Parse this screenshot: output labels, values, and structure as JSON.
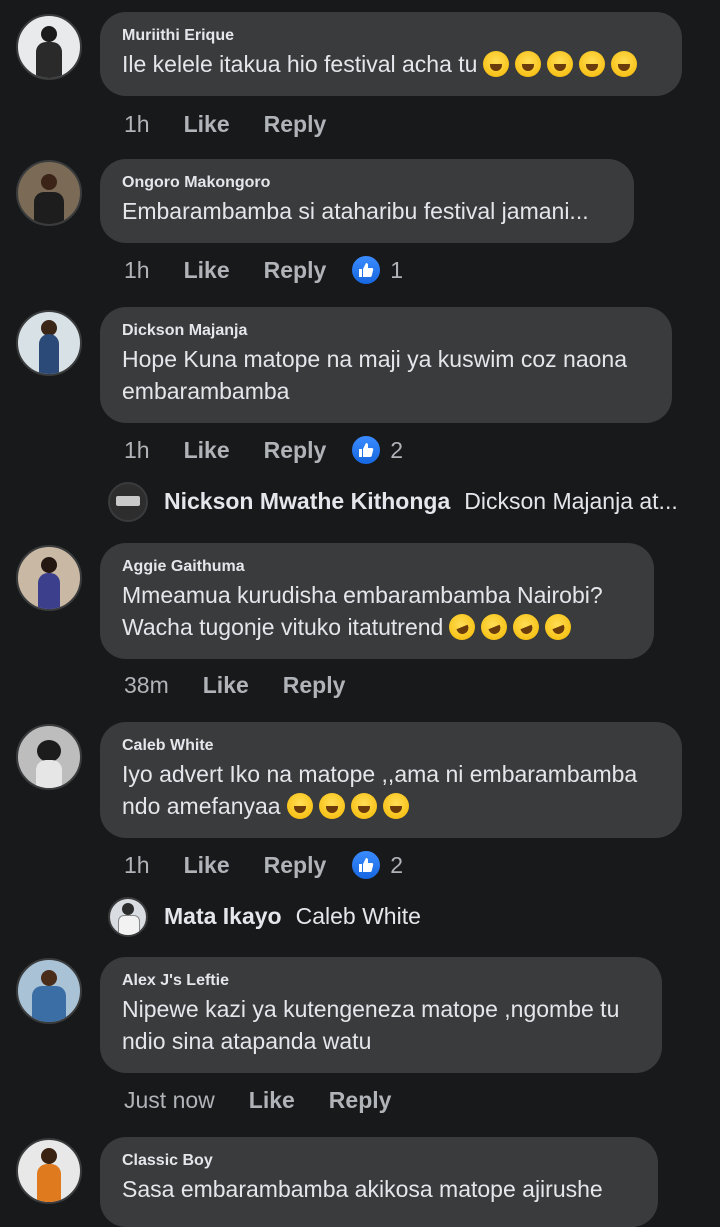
{
  "comments": [
    {
      "author": "Muriithi Erique",
      "text": "Ile kelele itakua hio festival acha tu",
      "emoji_count": 5,
      "time": "1h",
      "like": "Like",
      "reply": "Reply",
      "reaction_count": ""
    },
    {
      "author": "Ongoro Makongoro",
      "text": "Embarambamba si ataharibu festival jamani...",
      "time": "1h",
      "like": "Like",
      "reply": "Reply",
      "reaction_count": "1"
    },
    {
      "author": "Dickson Majanja",
      "text": "Hope Kuna matope na maji ya kuswim coz naona embarambamba",
      "time": "1h",
      "like": "Like",
      "reply": "Reply",
      "reaction_count": "2"
    },
    {
      "author": "Aggie Gaithuma",
      "text": "Mmeamua kurudisha embarambamba  Nairobi? Wacha tugonje vituko itatutrend",
      "time": "38m",
      "like": "Like",
      "reply": "Reply"
    },
    {
      "author": "Caleb White",
      "text": "Iyo advert Iko na matope ,,ama ni embarambamba ndo amefanyaa",
      "time": "1h",
      "like": "Like",
      "reply": "Reply",
      "reaction_count": "2"
    },
    {
      "author": "Alex J's Leftie",
      "text": "Nipewe kazi ya kutengeneza matope ,ngombe tu ndio sina atapanda watu",
      "time": "Just now",
      "like": "Like",
      "reply": "Reply"
    },
    {
      "author": "Classic Boy",
      "text": "Sasa embarambamba akikosa matope ajirushe"
    }
  ],
  "replies": [
    {
      "author": "Nickson Mwathe Kithonga",
      "text": "Dickson Majanja at..."
    },
    {
      "author": "Mata Ikayo",
      "text": "Caleb White"
    }
  ],
  "icons": {
    "reaction": "like-thumb-icon",
    "emoji": "laughing-emoji-icon"
  },
  "colors": {
    "background": "#18191a",
    "bubble": "#3a3b3c",
    "like_blue": "#1877f2"
  }
}
